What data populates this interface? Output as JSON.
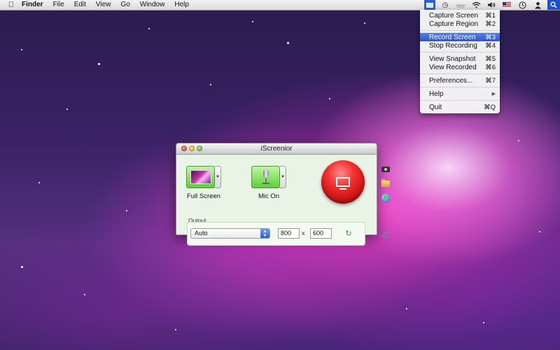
{
  "menubar": {
    "apple_icon": "apple-icon",
    "items": [
      {
        "label": "Finder",
        "bold": true
      },
      {
        "label": "File"
      },
      {
        "label": "Edit"
      },
      {
        "label": "View"
      },
      {
        "label": "Go"
      },
      {
        "label": "Window"
      },
      {
        "label": "Help"
      }
    ],
    "status_icons": [
      "iscreenior-menu-icon",
      "time-machine-icon",
      "bluetooth-icon",
      "wifi-icon",
      "volume-icon",
      "us-flag-icon",
      "clock-icon",
      "user-icon",
      "spotlight-icon"
    ]
  },
  "dropdown": {
    "items": [
      {
        "label": "Capture Screen",
        "shortcut": "⌘1"
      },
      {
        "label": "Capture Region",
        "shortcut": "⌘2"
      },
      {
        "separator": true
      },
      {
        "label": "Record Screen",
        "shortcut": "⌘3",
        "highlighted": true
      },
      {
        "label": "Stop Recording",
        "shortcut": "⌘4"
      },
      {
        "separator": true
      },
      {
        "label": "View Snapshot",
        "shortcut": "⌘5"
      },
      {
        "label": "View Recorded",
        "shortcut": "⌘6"
      },
      {
        "separator": true
      },
      {
        "label": "Preferences...",
        "shortcut": "⌘7"
      },
      {
        "separator": true
      },
      {
        "label": "Help",
        "shortcut": "▶"
      },
      {
        "separator": true
      },
      {
        "label": "Quit",
        "shortcut": "⌘Q"
      }
    ]
  },
  "window": {
    "title": "iScreenior",
    "full_screen_label": "Full Screen",
    "mic_label": "Mic On",
    "output_label": "Output",
    "output_select_value": "Auto",
    "width_value": "800",
    "x_separator": "x",
    "height_value": "600"
  },
  "colors": {
    "record_button": "#e41d1d",
    "menu_highlight": "#2a56d6",
    "green_button": "#6fd54a",
    "window_bg": "#e9f3e6"
  }
}
